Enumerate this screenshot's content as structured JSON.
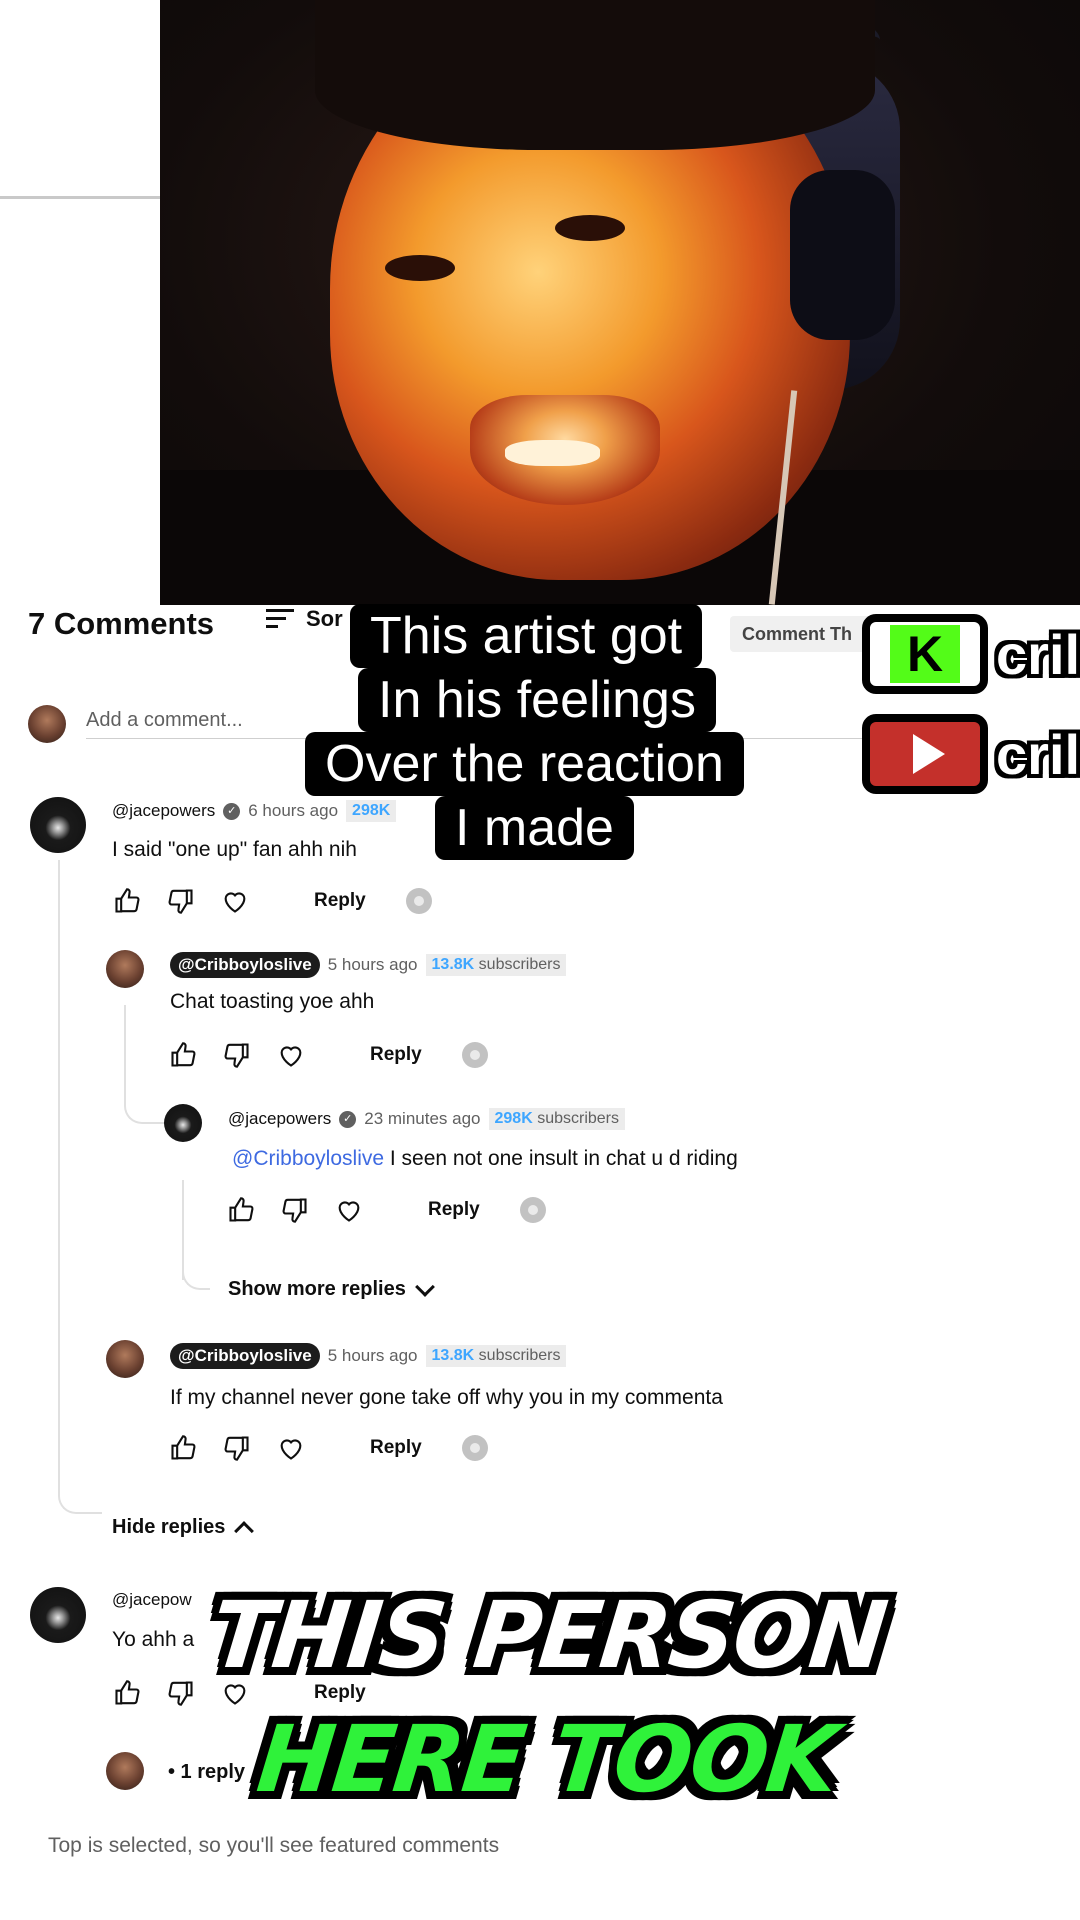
{
  "header": {
    "count": "7 Comments",
    "sort_label": "Sor",
    "tab_label": "Comment Th"
  },
  "add_comment": {
    "placeholder": "Add a comment..."
  },
  "comments": [
    {
      "handle": "@jacepowers",
      "verified": true,
      "time": "6 hours ago",
      "subs_num": "298K",
      "subs_label": "subscribers",
      "text": "I said \"one up\" fan ahh nih",
      "reply_label": "Reply"
    },
    {
      "handle": "@Cribboyloslive",
      "time": "5 hours ago",
      "subs_num": "13.8K",
      "subs_label": "subscribers",
      "text": "Chat toasting yoe ahh",
      "reply_label": "Reply"
    },
    {
      "handle": "@jacepowers",
      "verified": true,
      "time": "23 minutes ago",
      "subs_num": "298K",
      "subs_label": "subscribers",
      "mention": "@Cribboyloslive",
      "text": " I seen not one insult in chat u d riding",
      "reply_label": "Reply"
    },
    {
      "handle": "@Cribboyloslive",
      "time": "5 hours ago",
      "subs_num": "13.8K",
      "subs_label": "subscribers",
      "text": "If my channel never gone take off why you in my commenta",
      "reply_label": "Reply"
    },
    {
      "handle": "@jacepow",
      "text": "Yo ahh a",
      "reply_label": "Reply"
    }
  ],
  "show_more_replies": "Show more replies",
  "hide_replies": "Hide replies",
  "reply_count": "• 1 reply",
  "footer": "Top is selected, so you'll see featured comments",
  "caption_lines": [
    "This artist got",
    "In his feelings",
    "Over the reaction",
    "I made"
  ],
  "socials": [
    {
      "platform": "kick",
      "icon": "K",
      "handle": "cril",
      "color": "#53fc18"
    },
    {
      "platform": "youtube",
      "icon": "play-icon",
      "handle": "cril",
      "color": "#c4302b"
    }
  ],
  "big_overlay": {
    "line1": "THIS PERSON",
    "line2": "HERE TOOK",
    "line1_color": "#ffffff",
    "line2_color": "#2ff23a"
  }
}
